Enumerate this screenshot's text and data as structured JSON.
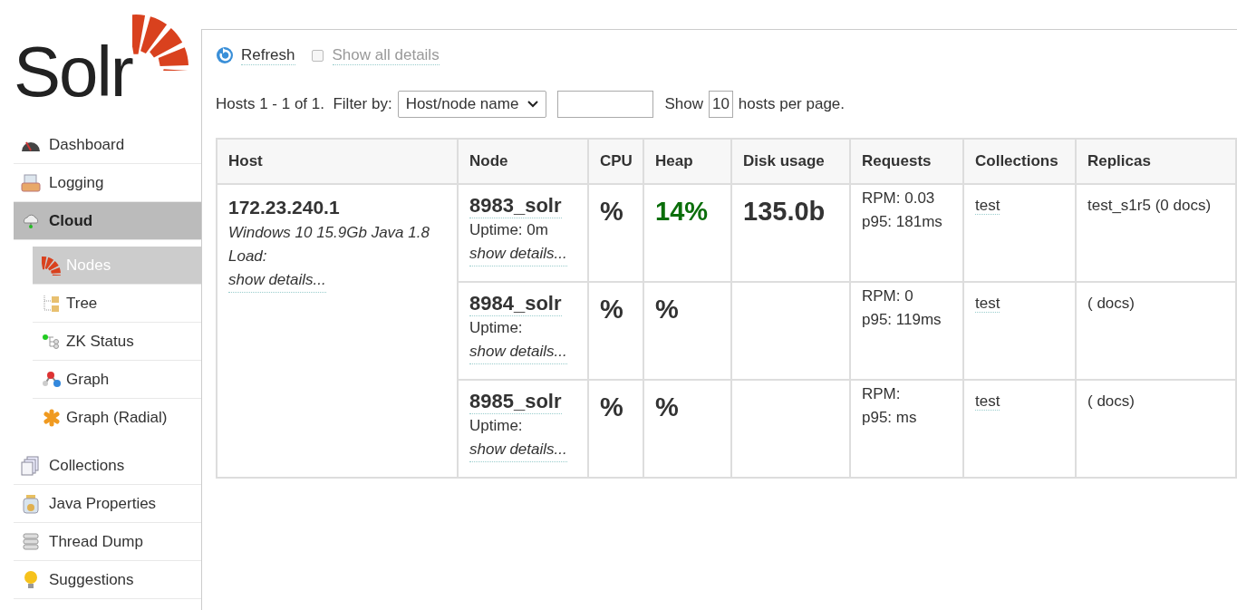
{
  "logo": {
    "text": "Solr"
  },
  "sidebar": {
    "items": [
      {
        "label": "Dashboard",
        "selected": false
      },
      {
        "label": "Logging",
        "selected": false
      },
      {
        "label": "Cloud",
        "selected": true,
        "children": [
          {
            "label": "Nodes",
            "selected": true
          },
          {
            "label": "Tree",
            "selected": false
          },
          {
            "label": "ZK Status",
            "selected": false
          },
          {
            "label": "Graph",
            "selected": false
          },
          {
            "label": "Graph (Radial)",
            "selected": false
          }
        ]
      },
      {
        "label": "Collections",
        "selected": false
      },
      {
        "label": "Java Properties",
        "selected": false
      },
      {
        "label": "Thread Dump",
        "selected": false
      },
      {
        "label": "Suggestions",
        "selected": false
      }
    ]
  },
  "toolbar": {
    "refresh": "Refresh",
    "show_all_details": {
      "label": "Show all details",
      "checked": false
    }
  },
  "pager": {
    "summary": "Hosts 1 - 1 of 1.",
    "filter_label": "Filter by:",
    "filter_select": "Host/node name",
    "show_label": "Show",
    "per_page": "10",
    "per_page_suffix": "hosts per page."
  },
  "table": {
    "columns": [
      "Host",
      "Node",
      "CPU",
      "Heap",
      "Disk usage",
      "Requests",
      "Collections",
      "Replicas"
    ],
    "hosts": [
      {
        "host": "172.23.240.1",
        "info": "Windows 10 15.9Gb Java 1.8",
        "load": "Load:",
        "details": "show details...",
        "nodes": [
          {
            "node": "8983_solr",
            "uptime": "Uptime: 0m",
            "details": "show details...",
            "cpu": "%",
            "heap": {
              "text": "14%",
              "color": "#0a6e0a"
            },
            "disk": "135.0b",
            "rpm": "RPM: 0.03",
            "p95": "p95: 181ms",
            "collections": "test",
            "replicas": "test_s1r5 (0 docs)"
          },
          {
            "node": "8984_solr",
            "uptime": "Uptime:",
            "details": "show details...",
            "cpu": "%",
            "heap": {
              "text": "%",
              "color": "#333333"
            },
            "rpm": "RPM: 0",
            "p95": "p95: 119ms",
            "collections": "test",
            "replicas": "( docs)"
          },
          {
            "node": "8985_solr",
            "uptime": "Uptime:",
            "details": "show details...",
            "cpu": "%",
            "heap": {
              "text": "%",
              "color": "#333333"
            },
            "rpm": "RPM:",
            "p95": "p95: ms",
            "collections": "test",
            "replicas": "( docs)"
          }
        ]
      }
    ]
  }
}
